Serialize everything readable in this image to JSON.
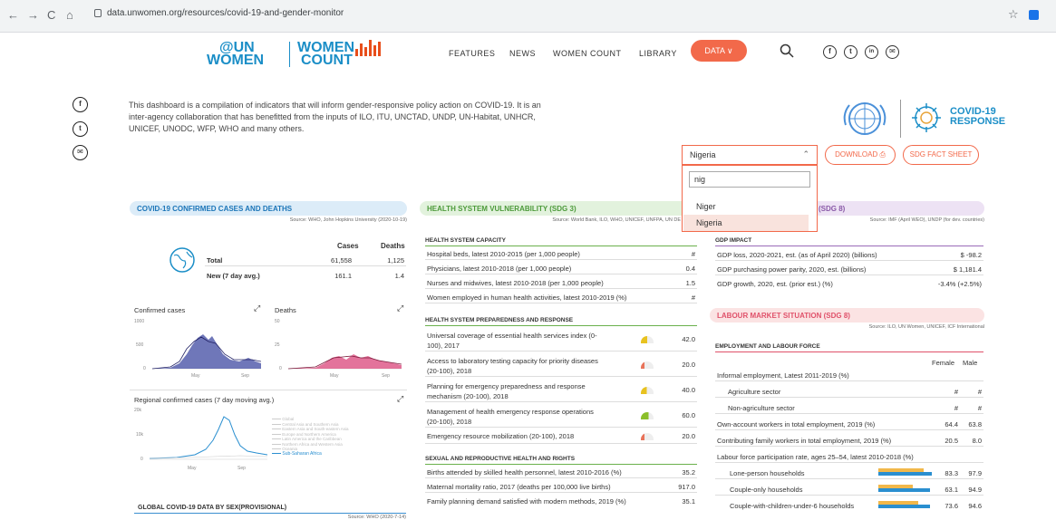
{
  "browser": {
    "back": "←",
    "forward": "→",
    "reload": "C",
    "home": "⌂",
    "url": "data.unwomen.org/resources/covid-19-and-gender-monitor",
    "star": "☆"
  },
  "header": {
    "logo_un": "@UN",
    "logo_women": "WOMEN",
    "logo_women_count_1": "WOMEN",
    "logo_women_count_2": "COUNT",
    "nav": [
      "FEATURES",
      "NEWS",
      "WOMEN COUNT",
      "LIBRARY"
    ],
    "data_button": "DATA ∨",
    "social": [
      "f",
      "t",
      "in",
      "✉"
    ]
  },
  "side_social": [
    "f",
    "t",
    "✉"
  ],
  "intro": "This dashboard is a compilation of indicators that will inform gender-responsive policy action on COVID-19. It is an inter-agency collaboration that has benefitted from the inputs of ILO, ITU, UNCTAD, UNDP, UN-Habitat, UNHCR, UNICEF, UNODC, WFP, WHO and many others.",
  "covid_logo": {
    "line1": "COVID-19",
    "line2": "RESPONSE"
  },
  "country_select": {
    "value": "Nigeria",
    "search_value": "nig",
    "options": [
      "Niger",
      "Nigeria"
    ],
    "selected": "Nigeria"
  },
  "buttons": {
    "download": "DOWNLOAD ⎙",
    "sdg": "SDG FACT SHEET"
  },
  "covid_section": {
    "title": "COVID-19 CONFIRMED CASES AND DEATHS",
    "source": "Source: WHO, John Hopkins University (2020-10-19)",
    "col_cases": "Cases",
    "col_deaths": "Deaths",
    "rows": [
      {
        "label": "Total",
        "cases": "61,558",
        "deaths": "1,125"
      },
      {
        "label": "New (7 day avg.)",
        "cases": "161.1",
        "deaths": "1.4"
      }
    ],
    "confirmed_title": "Confirmed cases",
    "deaths_title": "Deaths",
    "confirmed_ticks": [
      "1000",
      "500",
      "0"
    ],
    "deaths_ticks": [
      "50",
      "25",
      "0"
    ],
    "x_ticks": [
      "May",
      "Sep"
    ],
    "regional_title": "Regional confirmed cases (7 day moving avg.)",
    "regional_ticks": [
      "20k",
      "10k",
      "0"
    ],
    "regional_legend": [
      "Global",
      "Central Asia and Southern Asia",
      "Eastern Asia and South-eastern Asia",
      "Europe and Northern America",
      "Latin America and the Caribbean",
      "Northern Africa and Western Asia",
      "Oceania",
      "Sub-Saharan Africa"
    ],
    "global_title": "GLOBAL COVID-19 DATA BY SEX(PROVISIONAL)",
    "global_source": "Source: WHO (2020-7-14)"
  },
  "health_section": {
    "title": "HEALTH SYSTEM VULNERABILITY (SDG 3)",
    "source": "Source: World Bank, ILO, WHO, UNICEF, UNFPA, UN DE",
    "capacity_title": "HEALTH SYSTEM CAPACITY",
    "capacity": [
      {
        "label": "Hospital beds, latest 2010-2015 (per 1,000 people)",
        "value": "#"
      },
      {
        "label": "Physicians, latest 2010-2018 (per 1,000 people)",
        "value": "0.4"
      },
      {
        "label": "Nurses and midwives, latest 2010-2018 (per 1,000 people)",
        "value": "1.5"
      },
      {
        "label": "Women employed in human health activities, latest 2010-2019 (%)",
        "value": "#"
      }
    ],
    "prep_title": "HEALTH SYSTEM PREPAREDNESS AND RESPONSE",
    "prep": [
      {
        "label1": "Universal coverage of essential health services index (0-",
        "label2": "100), 2017",
        "value": "42.0",
        "gauge": "#e8c21f"
      },
      {
        "label1": "Access to laboratory testing capacity for priority diseases",
        "label2": "(20-100), 2018",
        "value": "20.0",
        "gauge": "#e8735a"
      },
      {
        "label1": "Planning for emergency preparedness and response",
        "label2": "mechanism (20-100), 2018",
        "value": "40.0",
        "gauge": "#e8c21f"
      },
      {
        "label1": "Management of health emergency response operations",
        "label2": "(20-100), 2018",
        "value": "60.0",
        "gauge": "#8bbf2a"
      },
      {
        "label1": "Emergency resource mobilization (20-100), 2018",
        "label2": "",
        "value": "20.0",
        "gauge": "#e8735a"
      }
    ],
    "srh_title": "SEXUAL AND REPRODUCTIVE HEALTH AND RIGHTS",
    "srh": [
      {
        "label": "Births attended by skilled health personnel, latest 2010-2016 (%)",
        "value": "35.2"
      },
      {
        "label": "Maternal mortality ratio, 2017 (deaths per 100,000 live births)",
        "value": "917.0"
      },
      {
        "label": "Family planning demand satisfied with modern methods, 2019 (%)",
        "value": "35.1"
      }
    ]
  },
  "econ_section": {
    "title": "(SDG 8)",
    "source": "Source: IMF (April WEO), UNDP (for dev. countries)",
    "gdp_title": "GDP IMPACT",
    "gdp": [
      {
        "label": "GDP loss, 2020-2021, est. (as of April 2020) (billions)",
        "value": "$ -98.2"
      },
      {
        "label": "GDP purchasing power parity, 2020, est. (billions)",
        "value": "$ 1,181.4"
      },
      {
        "label": "GDP growth, 2020, est. (prior est.) (%)",
        "value": "-3.4% (+2.5%)"
      }
    ]
  },
  "labour_section": {
    "title": "LABOUR MARKET SITUATION (SDG 8)",
    "source": "Source: ILO, UN Women, UNICEF, ICF International",
    "emp_title": "EMPLOYMENT AND LABOUR FORCE",
    "col_female": "Female",
    "col_male": "Male",
    "informal": "Informal employment, Latest 2011-2019 (%)",
    "sectors": [
      {
        "label": "Agriculture sector",
        "female": "#",
        "male": "#"
      },
      {
        "label": "Non-agriculture sector",
        "female": "#",
        "male": "#"
      }
    ],
    "rows": [
      {
        "label": "Own-account workers in total employment, 2019 (%)",
        "female": "64.4",
        "male": "63.8"
      },
      {
        "label": "Contributing family workers in total employment, 2019 (%)",
        "female": "20.5",
        "male": "8.0"
      }
    ],
    "lfp": "Labour force participation rate, ages 25–54, latest 2010-2018 (%)",
    "households": [
      {
        "label": "Lone-person households",
        "female": "83.3",
        "male": "97.9",
        "female_frac": 0.833,
        "male_frac": 0.979
      },
      {
        "label": "Couple-only households",
        "female": "63.1",
        "male": "94.9",
        "female_frac": 0.631,
        "male_frac": 0.949
      },
      {
        "label": "Couple-with-children-under-6 households",
        "female": "73.6",
        "male": "94.6",
        "female_frac": 0.736,
        "male_frac": 0.946
      }
    ]
  }
}
